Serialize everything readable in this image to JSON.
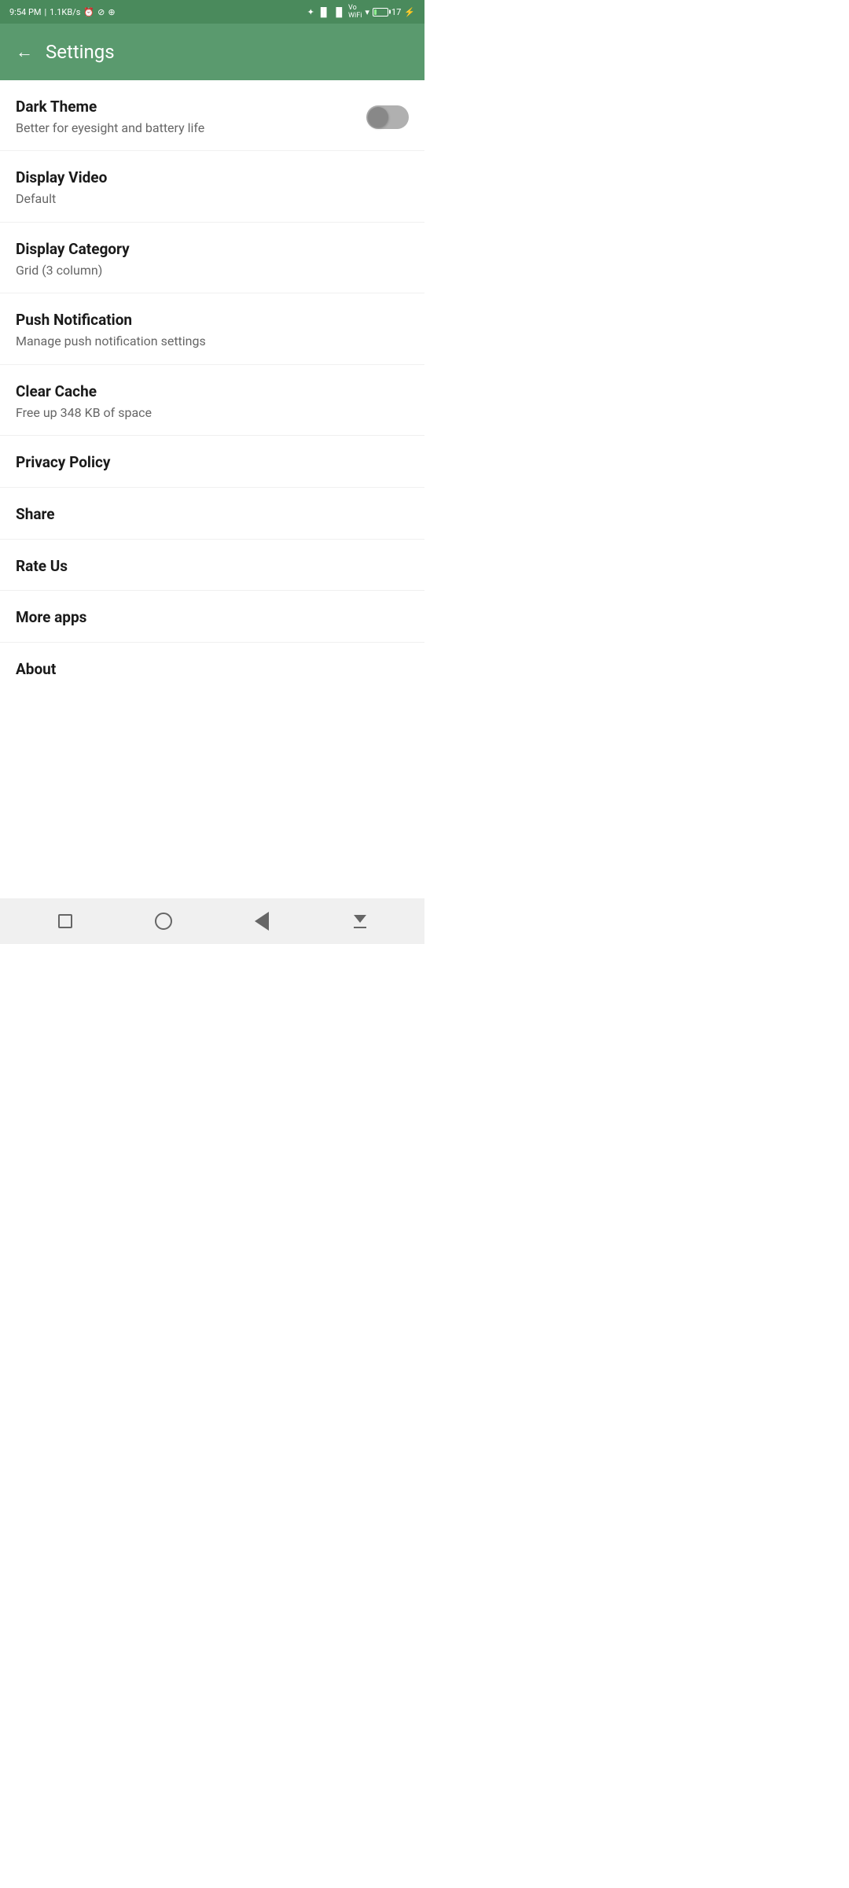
{
  "statusBar": {
    "time": "9:54 PM",
    "networkSpeed": "1.1KB/s",
    "batteryPercent": "17"
  },
  "appBar": {
    "backLabel": "←",
    "title": "Settings"
  },
  "settings": {
    "items": [
      {
        "id": "dark-theme",
        "title": "Dark Theme",
        "subtitle": "Better for eyesight and battery life",
        "hasToggle": true,
        "toggleOn": false,
        "isClickable": true
      },
      {
        "id": "display-video",
        "title": "Display Video",
        "subtitle": "Default",
        "hasToggle": false,
        "isClickable": true
      },
      {
        "id": "display-category",
        "title": "Display Category",
        "subtitle": "Grid (3 column)",
        "hasToggle": false,
        "isClickable": true
      },
      {
        "id": "push-notification",
        "title": "Push Notification",
        "subtitle": "Manage push notification settings",
        "hasToggle": false,
        "isClickable": true
      },
      {
        "id": "clear-cache",
        "title": "Clear Cache",
        "subtitle": "Free up 348 KB of space",
        "hasToggle": false,
        "isClickable": true
      },
      {
        "id": "privacy-policy",
        "title": "Privacy Policy",
        "subtitle": "",
        "hasToggle": false,
        "isClickable": true
      },
      {
        "id": "share",
        "title": "Share",
        "subtitle": "",
        "hasToggle": false,
        "isClickable": true
      },
      {
        "id": "rate-us",
        "title": "Rate Us",
        "subtitle": "",
        "hasToggle": false,
        "isClickable": true
      },
      {
        "id": "more-apps",
        "title": "More apps",
        "subtitle": "",
        "hasToggle": false,
        "isClickable": true
      },
      {
        "id": "about",
        "title": "About",
        "subtitle": "",
        "hasToggle": false,
        "isClickable": true
      }
    ]
  },
  "navBar": {
    "recentsLabel": "Recents",
    "homeLabel": "Home",
    "backLabel": "Back",
    "menuLabel": "Menu"
  }
}
